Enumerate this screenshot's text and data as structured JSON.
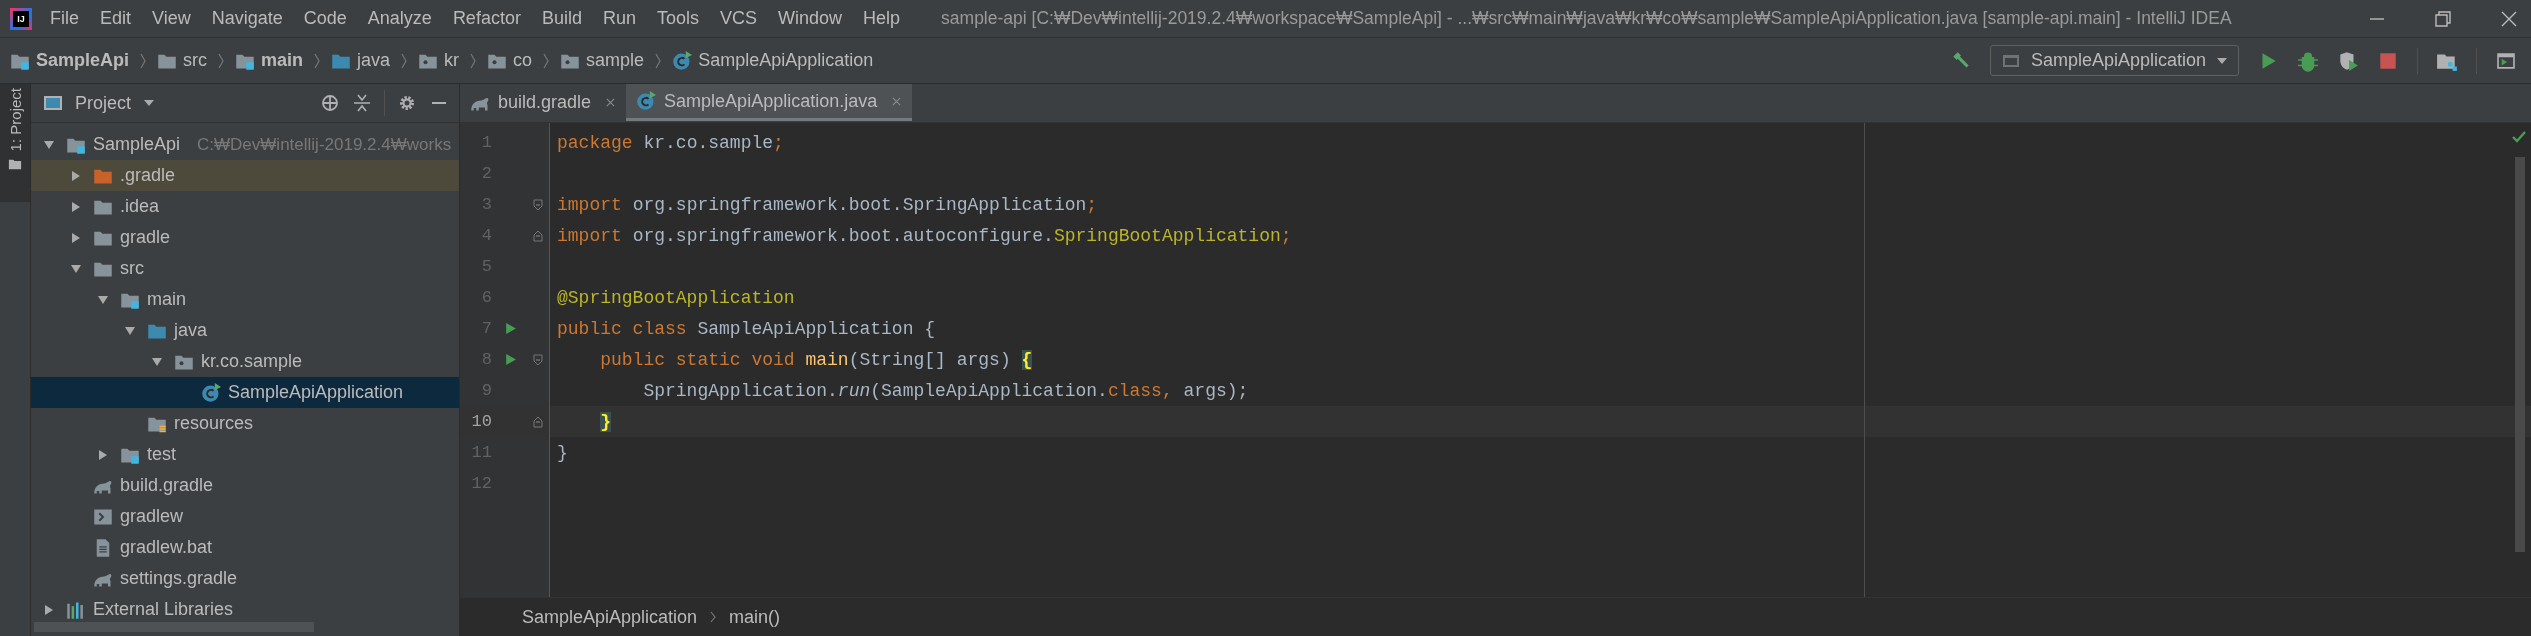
{
  "window": {
    "logo_text": "IJ",
    "title": "sample-api [C:₩Dev₩intellij-2019.2.4₩workspace₩SampleApi] - ...₩src₩main₩java₩kr₩co₩sample₩SampleApiApplication.java [sample-api.main] - IntelliJ IDEA"
  },
  "menu": [
    "File",
    "Edit",
    "View",
    "Navigate",
    "Code",
    "Analyze",
    "Refactor",
    "Build",
    "Run",
    "Tools",
    "VCS",
    "Window",
    "Help"
  ],
  "navigation_bar": [
    {
      "label": "SampleApi",
      "kind": "module",
      "bold": true
    },
    {
      "label": "src",
      "kind": "folder",
      "bold": false
    },
    {
      "label": "main",
      "kind": "module",
      "bold": true
    },
    {
      "label": "java",
      "kind": "source",
      "bold": false
    },
    {
      "label": "kr",
      "kind": "package",
      "bold": false
    },
    {
      "label": "co",
      "kind": "package",
      "bold": false
    },
    {
      "label": "sample",
      "kind": "package",
      "bold": false
    },
    {
      "label": "SampleApiApplication",
      "kind": "class",
      "bold": false
    }
  ],
  "toolbar": {
    "run_configuration": "SampleApiApplication"
  },
  "side_stripe": {
    "label": "1: Project"
  },
  "project_panel": {
    "title": "Project",
    "tree": [
      {
        "label": "SampleApi",
        "path": "C:₩Dev₩intellij-2019.2.4₩works",
        "kind": "module",
        "expanded": true,
        "selected": false,
        "children": [
          {
            "label": ".gradle",
            "kind": "excluded",
            "expanded": false,
            "selected": false
          },
          {
            "label": ".idea",
            "kind": "folder",
            "expanded": false,
            "selected": false
          },
          {
            "label": "gradle",
            "kind": "folder",
            "expanded": false,
            "selected": false
          },
          {
            "label": "src",
            "kind": "folder",
            "expanded": true,
            "selected": false,
            "children": [
              {
                "label": "main",
                "kind": "module",
                "expanded": true,
                "selected": false,
                "children": [
                  {
                    "label": "java",
                    "kind": "source",
                    "expanded": true,
                    "selected": false,
                    "children": [
                      {
                        "label": "kr.co.sample",
                        "kind": "package",
                        "expanded": true,
                        "selected": false,
                        "children": [
                          {
                            "label": "SampleApiApplication",
                            "kind": "class",
                            "selected": true
                          }
                        ]
                      }
                    ]
                  },
                  {
                    "label": "resources",
                    "kind": "resources",
                    "selected": false
                  }
                ]
              },
              {
                "label": "test",
                "kind": "module",
                "expanded": false,
                "selected": false
              }
            ]
          },
          {
            "label": "build.gradle",
            "kind": "gradle",
            "selected": false
          },
          {
            "label": "gradlew",
            "kind": "script",
            "selected": false
          },
          {
            "label": "gradlew.bat",
            "kind": "text",
            "selected": false
          },
          {
            "label": "settings.gradle",
            "kind": "gradle",
            "selected": false
          }
        ]
      },
      {
        "label": "External Libraries",
        "kind": "libraries",
        "expanded": false,
        "selected": false
      }
    ]
  },
  "tabs": [
    {
      "label": "build.gradle",
      "kind": "gradle",
      "selected": false
    },
    {
      "label": "SampleApiApplication.java",
      "kind": "class",
      "selected": true
    }
  ],
  "editor": {
    "lines": [
      {
        "number": "1",
        "current": false,
        "run": false,
        "fold_start": false,
        "fold_end": false,
        "tokens": [
          {
            "kind": "kw",
            "text": "package "
          },
          {
            "kind": "plain",
            "text": "kr.co.sample"
          },
          {
            "kind": "kw",
            "text": ";"
          }
        ]
      },
      {
        "number": "2",
        "current": false,
        "run": false,
        "fold_start": false,
        "fold_end": false
      },
      {
        "number": "3",
        "current": false,
        "run": false,
        "fold_start": true,
        "fold_end": false,
        "tokens": [
          {
            "kind": "kw",
            "text": "import "
          },
          {
            "kind": "plain",
            "text": "org.springframework.boot.SpringApplication"
          },
          {
            "kind": "kw",
            "text": ";"
          }
        ]
      },
      {
        "number": "4",
        "current": false,
        "run": false,
        "fold_start": false,
        "fold_end": true,
        "tokens": [
          {
            "kind": "kw",
            "text": "import "
          },
          {
            "kind": "plain",
            "text": "org.springframework.boot.autoconfigure."
          },
          {
            "kind": "ann",
            "text": "SpringBootApplication"
          },
          {
            "kind": "kw",
            "text": ";"
          }
        ]
      },
      {
        "number": "5",
        "current": false,
        "run": false,
        "fold_start": false,
        "fold_end": false
      },
      {
        "number": "6",
        "current": false,
        "run": false,
        "fold_start": false,
        "fold_end": false,
        "tokens": [
          {
            "kind": "ann",
            "text": "@SpringBootApplication"
          }
        ]
      },
      {
        "number": "7",
        "current": false,
        "run": true,
        "fold_start": false,
        "fold_end": false,
        "tokens": [
          {
            "kind": "kw",
            "text": "public class "
          },
          {
            "kind": "plain",
            "text": "SampleApiApplication {"
          }
        ]
      },
      {
        "number": "8",
        "current": false,
        "run": true,
        "fold_start": true,
        "fold_end": false,
        "tokens": [
          {
            "kind": "kw",
            "text": "    public static void "
          },
          {
            "kind": "fn",
            "text": "main"
          },
          {
            "kind": "plain",
            "text": "(String[] args) "
          },
          {
            "kind": "brace",
            "text": "{"
          }
        ]
      },
      {
        "number": "9",
        "current": false,
        "run": false,
        "fold_start": false,
        "fold_end": false,
        "tokens": [
          {
            "kind": "plain",
            "text": "        SpringApplication."
          },
          {
            "kind": "italic",
            "text": "run"
          },
          {
            "kind": "plain",
            "text": "(SampleApiApplication."
          },
          {
            "kind": "kw",
            "text": "class, "
          },
          {
            "kind": "plain",
            "text": "args);"
          }
        ]
      },
      {
        "number": "10",
        "current": true,
        "run": false,
        "fold_start": false,
        "fold_end": true,
        "tokens": [
          {
            "kind": "brace",
            "text": "    }"
          }
        ]
      },
      {
        "number": "11",
        "current": false,
        "run": false,
        "fold_start": false,
        "fold_end": false,
        "tokens": [
          {
            "kind": "plain",
            "text": "}"
          }
        ]
      },
      {
        "number": "12",
        "current": false,
        "run": false,
        "fold_start": false,
        "fold_end": false
      }
    ],
    "breadcrumbs": [
      "SampleApiApplication",
      "main()"
    ]
  }
}
